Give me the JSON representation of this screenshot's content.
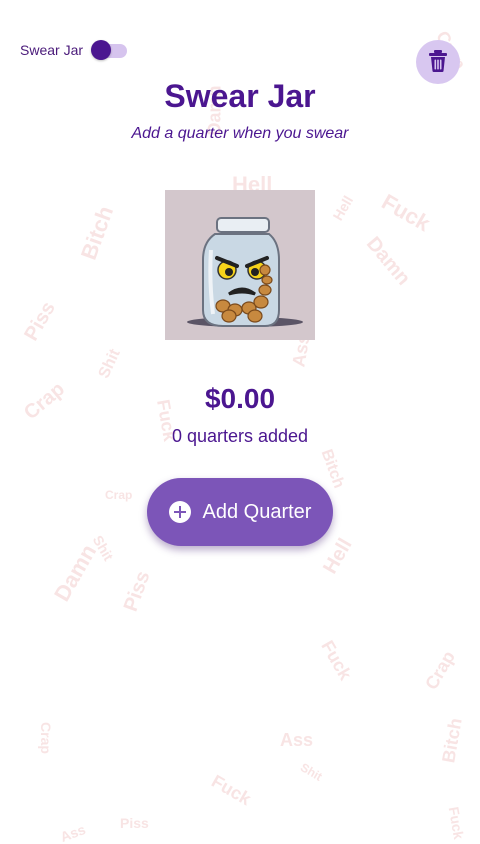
{
  "toggle": {
    "label": "Swear Jar",
    "on": false
  },
  "header": {
    "title": "Swear Jar",
    "subtitle": "Add a quarter when you swear"
  },
  "jar": {
    "image_alt": "angry jar with coins"
  },
  "totals": {
    "amount": "$0.00",
    "count_text": "0 quarters added"
  },
  "actions": {
    "add_label": "Add Quarter",
    "add_icon": "plus-circle-icon",
    "delete_icon": "trash-icon"
  },
  "colors": {
    "primary": "#4b1690",
    "button": "#7c55b8",
    "trash_bg": "#d8c7f0",
    "watermark": "#f3cfcf"
  },
  "watermark_words": [
    "Hell",
    "Fuck",
    "Damn",
    "Bitch",
    "Piss",
    "Shit",
    "Crap",
    "Ass",
    "Fuck",
    "Bitch",
    "Crap",
    "Shit",
    "Damn",
    "Piss",
    "Hell",
    "Fuck",
    "Crap",
    "Ass",
    "Bitch",
    "Shit",
    "Fuck",
    "Crap",
    "Damn",
    "Hell",
    "Piss",
    "Fuck",
    "Ass",
    "Crap"
  ]
}
